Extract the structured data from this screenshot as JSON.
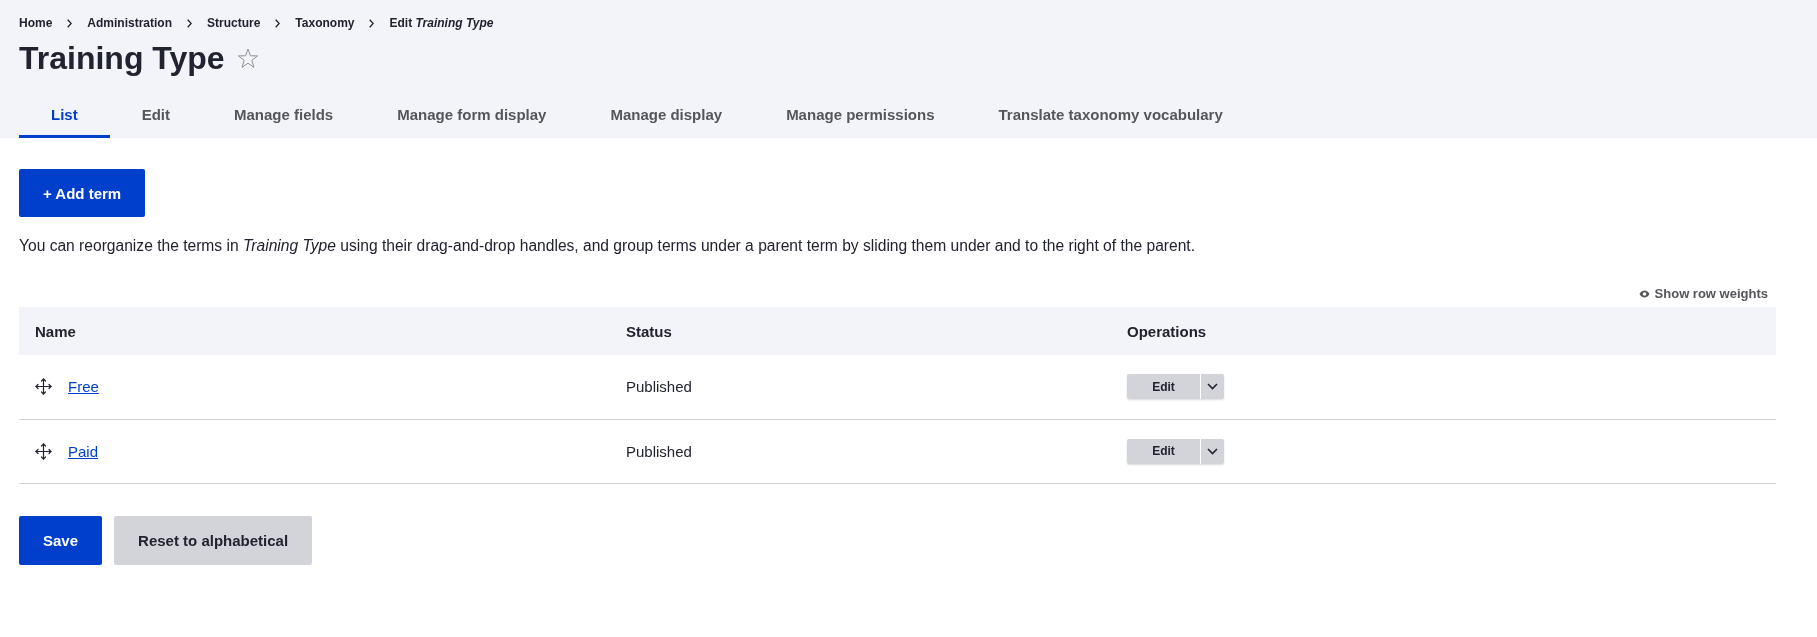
{
  "breadcrumb": [
    {
      "label": "Home"
    },
    {
      "label": "Administration"
    },
    {
      "label": "Structure"
    },
    {
      "label": "Taxonomy"
    },
    {
      "label": "Edit *Training Type*"
    }
  ],
  "page_title": "Training Type",
  "shortcut": {
    "starred": false
  },
  "tabs": [
    {
      "label": "List",
      "selected": true
    },
    {
      "label": "Edit",
      "selected": false
    },
    {
      "label": "Manage fields",
      "selected": false
    },
    {
      "label": "Manage form display",
      "selected": false
    },
    {
      "label": "Manage display",
      "selected": false
    },
    {
      "label": "Manage permissions",
      "selected": false
    },
    {
      "label": "Translate taxonomy vocabulary",
      "selected": false
    }
  ],
  "add_button": "+ Add term",
  "description": "You can reorganize the terms in *Training Type* using their drag-and-drop handles, and group terms under a parent term by sliding them under and to the right of the parent.",
  "row_weights_toggle": "Show row weights",
  "table": {
    "columns": [
      "Name",
      "Status",
      "Operations"
    ],
    "rows": [
      {
        "name": "Free",
        "status": "Published",
        "operation": "Edit"
      },
      {
        "name": "Paid",
        "status": "Published",
        "operation": "Edit"
      }
    ]
  },
  "actions": [
    {
      "label": "Save",
      "kind": "primary"
    },
    {
      "label": "Reset to alphabetical",
      "kind": "secondary"
    }
  ]
}
